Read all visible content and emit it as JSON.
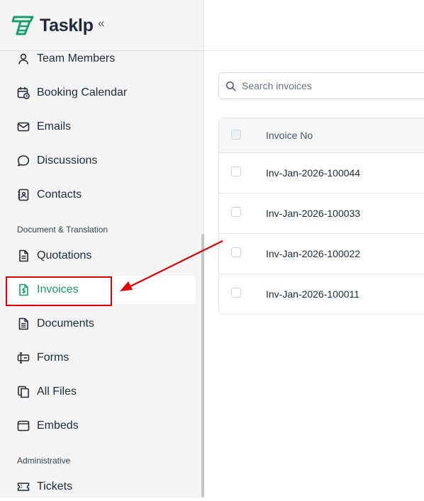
{
  "app": {
    "name": "Tasklp",
    "collapse_glyph": "«",
    "accent_color": "#16a06c"
  },
  "sidebar": {
    "items_top": [
      {
        "label": "Team Members",
        "icon": "user-icon"
      },
      {
        "label": "Booking Calendar",
        "icon": "calendar-clock-icon"
      },
      {
        "label": "Emails",
        "icon": "mail-icon"
      },
      {
        "label": "Discussions",
        "icon": "chat-bubble-icon"
      },
      {
        "label": "Contacts",
        "icon": "contact-book-icon"
      }
    ],
    "section_document": "Document & Translation",
    "items_document": [
      {
        "label": "Quotations",
        "icon": "document-icon"
      },
      {
        "label": "Invoices",
        "icon": "invoice-dollar-icon",
        "active": true
      },
      {
        "label": "Documents",
        "icon": "document-lines-icon"
      },
      {
        "label": "Forms",
        "icon": "form-field-icon"
      },
      {
        "label": "All Files",
        "icon": "files-copy-icon"
      },
      {
        "label": "Embeds",
        "icon": "embed-window-icon"
      }
    ],
    "section_admin": "Administrative",
    "items_admin": [
      {
        "label": "Tickets",
        "icon": "ticket-icon"
      }
    ]
  },
  "search": {
    "placeholder": "Search invoices"
  },
  "table": {
    "columns": [
      "Invoice No"
    ],
    "rows": [
      "Inv-Jan-2026-100044",
      "Inv-Jan-2026-100033",
      "Inv-Jan-2026-100022",
      "Inv-Jan-2026-100011"
    ]
  },
  "annotation": {
    "color": "#e00000"
  }
}
